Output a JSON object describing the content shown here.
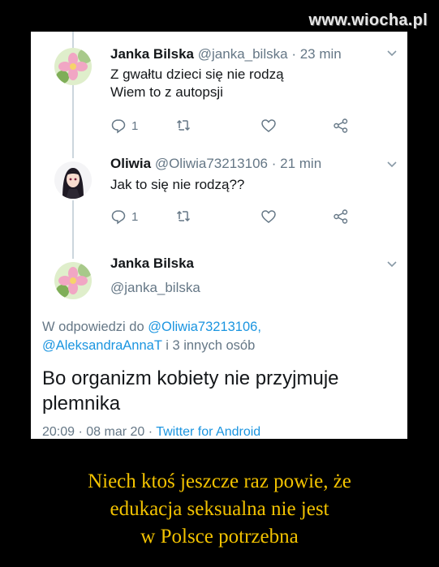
{
  "watermark": "www.wiocha.pl",
  "tweets": [
    {
      "name": "Janka Bilska",
      "handle": "@janka_bilska",
      "dot": "·",
      "time": "23 min",
      "lines": [
        "Z gwałtu dzieci się nie rodzą",
        "Wiem to z autopsji"
      ],
      "reply_count": "1"
    },
    {
      "name": "Oliwia",
      "handle": "@Oliwia73213106",
      "dot": "·",
      "time": "21 min",
      "lines": [
        "Jak to się nie rodzą??"
      ],
      "reply_count": "1"
    }
  ],
  "focus_tweet": {
    "name": "Janka Bilska",
    "handle": "@janka_bilska",
    "reply_prefix": "W odpowiedzi do ",
    "reply_link1": "@Oliwia73213106,",
    "reply_link2": "@AleksandraAnnaT",
    "reply_suffix": " i 3 innych osób",
    "text": "Bo organizm kobiety nie przyjmuje plemnika",
    "meta_time": "20:09 · 08 mar 20 · ",
    "meta_source": "Twitter for Android"
  },
  "caption": {
    "line1": "Niech ktoś jeszcze raz powie, że",
    "line2": "edukacja seksualna nie jest",
    "line3": "w Polsce potrzebna"
  },
  "colors": {
    "background": "#000000",
    "panel": "#ffffff",
    "link": "#1b95e0",
    "muted": "#657786",
    "caption": "#f2c200"
  },
  "icons": [
    "reply-icon",
    "retweet-icon",
    "like-icon",
    "share-icon",
    "chevron-down-icon"
  ]
}
